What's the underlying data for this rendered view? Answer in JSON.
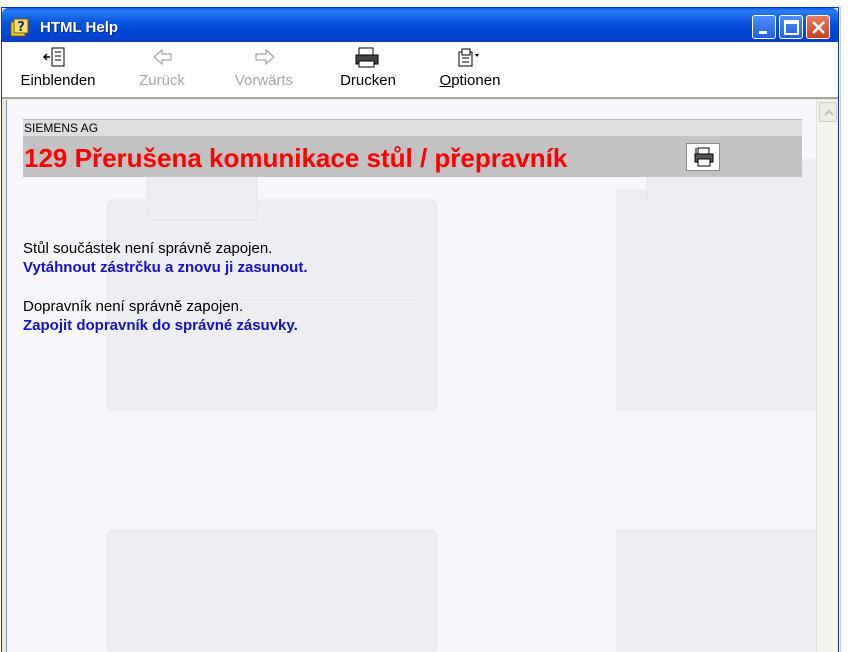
{
  "window": {
    "title": "HTML Help"
  },
  "toolbar": {
    "einblenden": "Einblenden",
    "zurueck": "Zurück",
    "vorwaerts": "Vorwärts",
    "drucken": "Drucken",
    "optionen": "Optionen"
  },
  "topic": {
    "company": "SIEMENS AG",
    "title": "129 Přerušena komunikace stůl / přepravník",
    "items": [
      {
        "cause": "Stůl součástek není správně zapojen.",
        "remedy": "Vytáhnout zástrčku a znovu ji zasunout."
      },
      {
        "cause": "Dopravník není správně zapojen.",
        "remedy": "Zapojit dopravník do správné zásuvky."
      }
    ]
  },
  "colors": {
    "title_red": "#ff0000",
    "remedy_blue": "#1212d0",
    "titlebar_blue": "#0a56e0"
  }
}
